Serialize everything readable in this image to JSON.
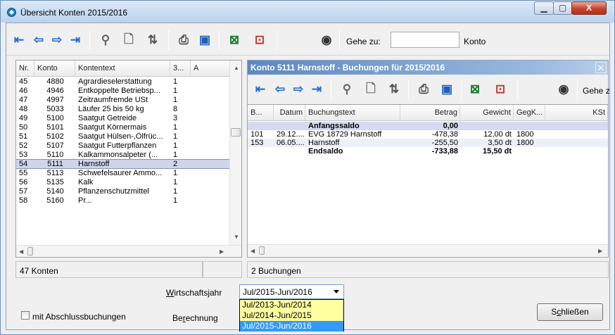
{
  "window": {
    "title": "Übersicht Konten 2015/2016",
    "min_glyph": "▁",
    "max_glyph": "▢",
    "close_glyph": "X"
  },
  "toolbar": {
    "goto_label": "Gehe zu:",
    "goto_value": "",
    "goto_suffix": "Konto"
  },
  "accounts": {
    "columns": [
      "Nr.",
      "Konto",
      "Kontentext",
      "3...",
      "A"
    ],
    "rows": [
      {
        "nr": "45",
        "konto": "4880",
        "text": "Agrardieselerstattung",
        "c3": "1"
      },
      {
        "nr": "46",
        "konto": "4946",
        "text": "Entkoppelte Betriebsp...",
        "c3": "1"
      },
      {
        "nr": "47",
        "konto": "4997",
        "text": "Zeitraumfremde USt",
        "c3": "1"
      },
      {
        "nr": "48",
        "konto": "5033",
        "text": "Läufer 25 bis 50 kg",
        "c3": "8"
      },
      {
        "nr": "49",
        "konto": "5100",
        "text": "Saatgut Getreide",
        "c3": "3"
      },
      {
        "nr": "50",
        "konto": "5101",
        "text": "Saatgut Körnermais",
        "c3": "1"
      },
      {
        "nr": "51",
        "konto": "5102",
        "text": "Saatgut Hülsen-,Ölfrüc...",
        "c3": "1"
      },
      {
        "nr": "52",
        "konto": "5107",
        "text": "Saatgut Futterpflanzen",
        "c3": "1"
      },
      {
        "nr": "53",
        "konto": "5110",
        "text": "Kalkammonsalpeter (...",
        "c3": "1"
      },
      {
        "nr": "54",
        "konto": "5111",
        "text": "Harnstoff",
        "c3": "2"
      },
      {
        "nr": "55",
        "konto": "5113",
        "text": "Schwefelsaurer Ammo...",
        "c3": "1"
      },
      {
        "nr": "56",
        "konto": "5135",
        "text": "Kalk",
        "c3": "1"
      },
      {
        "nr": "57",
        "konto": "5140",
        "text": "Pflanzenschutzmittel",
        "c3": "1"
      },
      {
        "nr": "58",
        "konto": "5160",
        "text": "Pr...",
        "c3": "1"
      }
    ],
    "selected_index": 9,
    "status": "47 Konten"
  },
  "bookings": {
    "title": "Konto 5111 Harnstoff -  Buchungen für 2015/2016",
    "goto_label": "Gehe z",
    "columns": [
      "B...",
      "Datum",
      "Buchungstext",
      "Betrag",
      "Gewicht",
      "GegK...",
      "KSt"
    ],
    "rows": [
      {
        "b": "",
        "datum": "",
        "text": "Anfangssaldo",
        "betrag": "0,00",
        "gewicht": "",
        "gegk": "",
        "kst": "",
        "bold": true,
        "highlight": true
      },
      {
        "b": "101",
        "datum": "29.12....",
        "text": "EVG 18729 Harnstoff",
        "betrag": "-478,38",
        "gewicht": "12,00 dt",
        "gegk": "1800",
        "kst": "",
        "bold": false,
        "highlight": false
      },
      {
        "b": "153",
        "datum": "06.05....",
        "text": "Harnstoff",
        "betrag": "-255,50",
        "gewicht": "3,50 dt",
        "gegk": "1800",
        "kst": "",
        "bold": false,
        "highlight": true
      },
      {
        "b": "",
        "datum": "",
        "text": "Endsaldo",
        "betrag": "-733,88",
        "gewicht": "15,50 dt",
        "gegk": "",
        "kst": "",
        "bold": true,
        "highlight": false
      }
    ],
    "status": "2 Buchungen"
  },
  "bottom": {
    "wj_label": "Wirtschaftsjahr",
    "wj_value": "Jul/2015-Jun/2016",
    "wj_options": [
      "Jul/2013-Jun/2014",
      "Jul/2014-Jun/2015",
      "Jul/2015-Jun/2016"
    ],
    "wj_selected": 2,
    "checkbox_label": "mit Abschlussbuchungen",
    "berechnung_label": "Berechnung",
    "close_button": "Schließen"
  },
  "colors": {
    "selected_row": "#cfd5eb",
    "panel_title": "#5d88c0",
    "dropdown_bg": "#ffffa0",
    "dropdown_sel": "#3399ff"
  }
}
